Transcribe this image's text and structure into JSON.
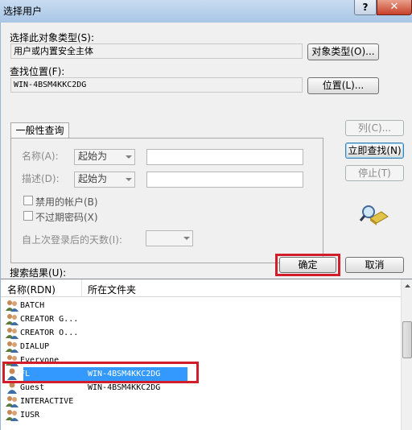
{
  "window": {
    "title": "选择用户",
    "help_label": "?",
    "close_label": "✕"
  },
  "object_type": {
    "label": "选择此对象类型(S):",
    "value": "用户或内置安全主体",
    "button": "对象类型(O)..."
  },
  "location": {
    "label": "查找位置(F):",
    "value": "WIN-4BSM4KKC2DG",
    "button": "位置(L)..."
  },
  "query_tab": {
    "label": "一般性查询"
  },
  "query": {
    "name_label": "名称(A):",
    "name_mode": "起始为",
    "desc_label": "描述(D):",
    "desc_mode": "起始为",
    "disabled_accounts": "禁用的帐户(B)",
    "non_expiring_pw": "不过期密码(X)",
    "days_since_logon": "自上次登录后的天数(I):"
  },
  "side_buttons": {
    "columns": "列(C)...",
    "find_now": "立即查找(N)",
    "stop": "停止(T)"
  },
  "results_label": "搜索结果(U):",
  "actions": {
    "ok": "确定",
    "cancel": "取消"
  },
  "results": {
    "columns": [
      "名称(RDN)",
      "所在文件夹"
    ],
    "rows": [
      {
        "name": "BATCH",
        "folder": "",
        "icon": "group-icon"
      },
      {
        "name": "CREATOR G...",
        "folder": "",
        "icon": "group-icon"
      },
      {
        "name": "CREATOR O...",
        "folder": "",
        "icon": "group-icon"
      },
      {
        "name": "DIALUP",
        "folder": "",
        "icon": "group-icon"
      },
      {
        "name": "Everyone",
        "folder": "",
        "icon": "group-icon"
      },
      {
        "name": "FL",
        "folder": "WIN-4BSM4KKC2DG",
        "icon": "user-icon",
        "selected": true
      },
      {
        "name": "Guest",
        "folder": "WIN-4BSM4KKC2DG",
        "icon": "user-icon"
      },
      {
        "name": "INTERACTIVE",
        "folder": "",
        "icon": "group-icon"
      },
      {
        "name": "IUSR",
        "folder": "",
        "icon": "group-icon"
      }
    ]
  },
  "colors": {
    "highlight": "#d21e2a",
    "selection": "#3399ff"
  }
}
